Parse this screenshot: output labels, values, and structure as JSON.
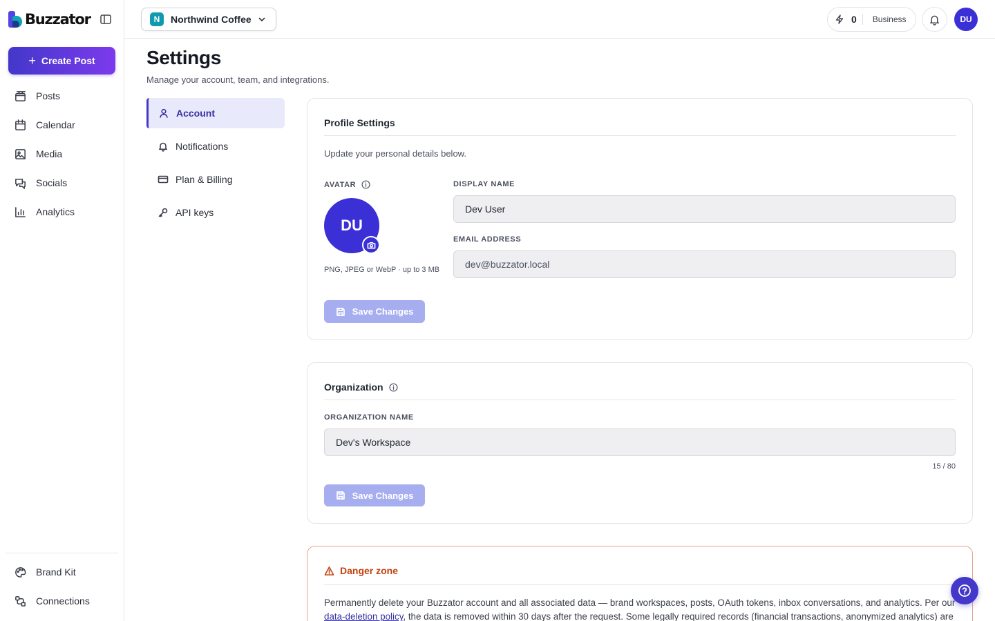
{
  "app": {
    "brand": "Buzzator"
  },
  "sidebar": {
    "create_label": "Create Post",
    "items": [
      {
        "label": "Posts",
        "icon": "posts-icon"
      },
      {
        "label": "Calendar",
        "icon": "calendar-icon"
      },
      {
        "label": "Media",
        "icon": "image-icon"
      },
      {
        "label": "Socials",
        "icon": "chat-icon"
      },
      {
        "label": "Analytics",
        "icon": "bar-chart-icon"
      }
    ],
    "bottom_items": [
      {
        "label": "Brand Kit",
        "icon": "palette-icon"
      },
      {
        "label": "Connections",
        "icon": "connections-icon"
      }
    ]
  },
  "topbar": {
    "workspace_initial": "N",
    "workspace_name": "Northwind Coffee",
    "credits": "0",
    "plan": "Business",
    "user_initials": "DU"
  },
  "page": {
    "title": "Settings",
    "subtitle": "Manage your account, team, and integrations."
  },
  "settings_nav": [
    {
      "label": "Account",
      "active": true
    },
    {
      "label": "Notifications",
      "active": false
    },
    {
      "label": "Plan & Billing",
      "active": false
    },
    {
      "label": "API keys",
      "active": false
    }
  ],
  "profile": {
    "title": "Profile Settings",
    "description": "Update your personal details below.",
    "avatar_label": "AVATAR",
    "avatar_initials": "DU",
    "avatar_hint": "PNG, JPEG or WebP · up to 3 MB",
    "display_name_label": "DISPLAY NAME",
    "display_name_value": "Dev User",
    "email_label": "EMAIL ADDRESS",
    "email_value": "dev@buzzator.local",
    "save_label": "Save Changes"
  },
  "organization": {
    "title": "Organization",
    "name_label": "ORGANIZATION NAME",
    "name_value": "Dev's Workspace",
    "counter": "15 / 80",
    "save_label": "Save Changes"
  },
  "danger": {
    "title": "Danger zone",
    "text_before": "Permanently delete your Buzzator account and all associated data — brand workspaces, posts, OAuth tokens, inbox conversations, and analytics. Per our ",
    "link": "data-deletion policy",
    "text_after": ", the data is removed within 30 days after the request. Some legally required records (financial transactions, anonymized analytics) are"
  },
  "colors": {
    "accent": "#4338ca",
    "accent_light": "#e8e9fb",
    "danger": "#c2410c",
    "workspace_badge": "#0e9bb0"
  }
}
